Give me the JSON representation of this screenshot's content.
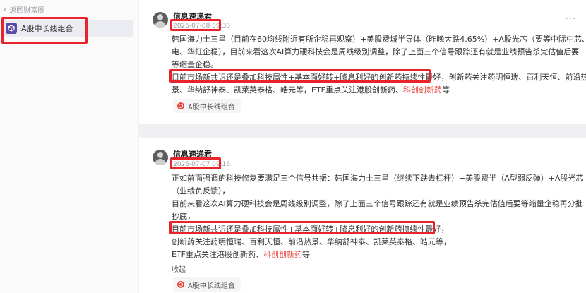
{
  "sidebar": {
    "back_label": "返回财富圈",
    "portfolio_label": "A股中长线组合",
    "icon_color": "#5b4ca8"
  },
  "posts": [
    {
      "author": "信息速递君",
      "time": "2026-07-08 09:33",
      "lines": [
        "韩国海力士三星（目前在60均线附近有所企稳再观察）+美股费城半导体（昨晚大跌4.65%）+A股光芯（要等中际中芯、长",
        "电、华虹企稳），目前来看这次AI算力硬科技会是周线级别调整，除了上面三个信号跟踪还有就是业绩预告杀完估值后要",
        "等缩量企稳。"
      ],
      "highlight": "目前市场新共识还是叠加科技属性+基本面好转+降息利好的创新药持续性最好",
      "after_highlight": "，创新药关注药明恒瑞、百利天恒、前沿热",
      "tail_line": "景、华纳舒神泰、凯莱英泰格、皓元等，ETF重点关注港股创新药、",
      "red_word": "科创创新药",
      "tail_end": "等",
      "tag": "A股中长线组合"
    },
    {
      "author": "信息速递君",
      "time": "2026-07-07 09:16",
      "lines": [
        "正如前面强调的科技修复要满足三个信号共振：韩国海力士三星（继续下跌去杠杆）+美股费半（A型弱反弹）+A股光芯",
        "（业绩负反馈），",
        "目前来看这次AI算力硬科技会是周线级别调整，除了上面三个信号跟踪还有就是业绩预告杀完估值后要等缩量企稳再分批",
        "抄底，"
      ],
      "highlight": "目前市场新共识还是叠加科技属性+基本面好转+降息利好的创新药持续性最好",
      "after_highlight": "，",
      "tail_line": "创新药关注药明恒瑞、百利天恒、前沿热景、华纳舒神泰、凯莱英泰格、皓元等，",
      "tail_line2": "ETF重点关注港股创新药、",
      "red_word": "科创创新药",
      "tail_end": "等",
      "collapse": "收起",
      "tag": "A股中长线组合"
    }
  ],
  "more_label": "···",
  "colors": {
    "accent_red": "#e8232c",
    "link_red": "#e8453c"
  }
}
